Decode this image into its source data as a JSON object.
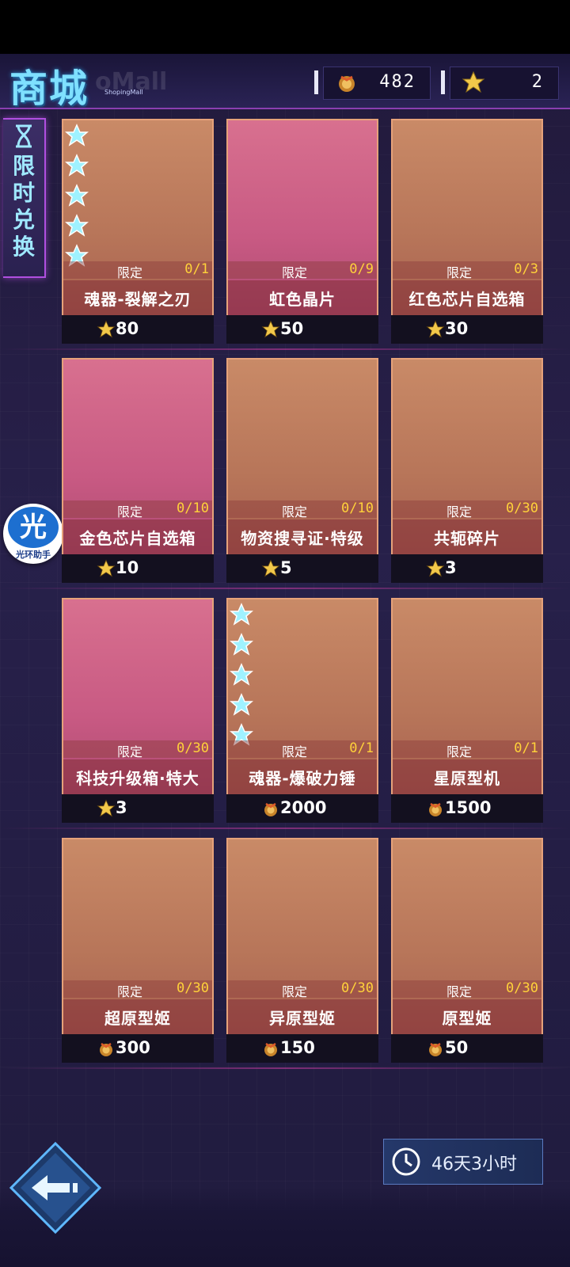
{
  "header": {
    "title": "商城",
    "subtitle": "ShopingMall",
    "ghost_text": "oMall",
    "coin_value": "482",
    "star_value": "2"
  },
  "side_tab": {
    "label": "限时兑换"
  },
  "assistant": {
    "icon_char": "光",
    "label": "光环助手"
  },
  "items": [
    {
      "name": "魂器-裂解之刃",
      "limit": "限定",
      "count": "0/1",
      "price": "80",
      "currency": "star",
      "bg": "tan",
      "stars": 5
    },
    {
      "name": "虹色晶片",
      "limit": "限定",
      "count": "0/9",
      "price": "50",
      "currency": "star",
      "bg": "pink",
      "stars": 0
    },
    {
      "name": "红色芯片自选箱",
      "limit": "限定",
      "count": "0/3",
      "price": "30",
      "currency": "star",
      "bg": "tan",
      "stars": 0
    },
    {
      "name": "金色芯片自选箱",
      "limit": "限定",
      "count": "0/10",
      "price": "10",
      "currency": "star",
      "bg": "pink",
      "stars": 0
    },
    {
      "name": "物资搜寻证·特级",
      "limit": "限定",
      "count": "0/10",
      "price": "5",
      "currency": "star",
      "bg": "tan",
      "stars": 0
    },
    {
      "name": "共轭碎片",
      "limit": "限定",
      "count": "0/30",
      "price": "3",
      "currency": "star",
      "bg": "tan",
      "stars": 0
    },
    {
      "name": "科技升级箱·特大",
      "limit": "限定",
      "count": "0/30",
      "price": "3",
      "currency": "star",
      "bg": "pink",
      "stars": 0
    },
    {
      "name": "魂器-爆破力锤",
      "limit": "限定",
      "count": "0/1",
      "price": "2000",
      "currency": "coin",
      "bg": "tan",
      "stars": 5
    },
    {
      "name": "星原型机",
      "limit": "限定",
      "count": "0/1",
      "price": "1500",
      "currency": "coin",
      "bg": "tan",
      "stars": 0
    },
    {
      "name": "超原型姬",
      "limit": "限定",
      "count": "0/30",
      "price": "300",
      "currency": "coin",
      "bg": "tan",
      "stars": 0
    },
    {
      "name": "异原型姬",
      "limit": "限定",
      "count": "0/30",
      "price": "150",
      "currency": "coin",
      "bg": "tan",
      "stars": 0
    },
    {
      "name": "原型姬",
      "limit": "限定",
      "count": "0/30",
      "price": "50",
      "currency": "coin",
      "bg": "tan",
      "stars": 0
    }
  ],
  "timer": {
    "text": "46天3小时"
  },
  "colors": {
    "accent": "#7fe0ff",
    "count": "#ffd23a",
    "frame": "#e6a27a"
  }
}
